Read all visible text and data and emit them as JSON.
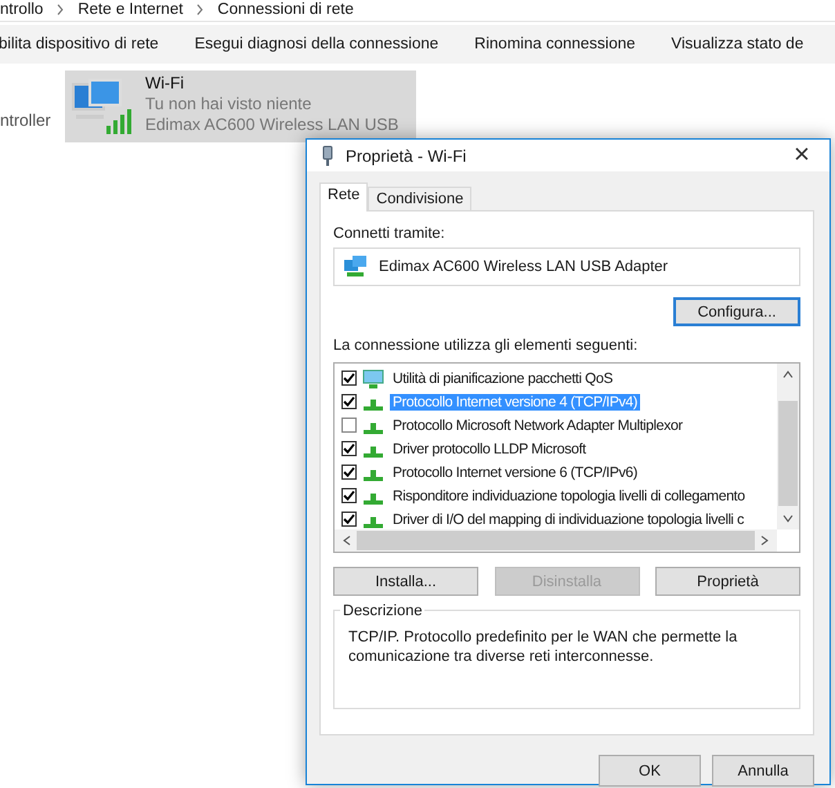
{
  "breadcrumb": [
    "ntrollo",
    "Rete e Internet",
    "Connessioni di rete"
  ],
  "toolbar": [
    "bilita dispositivo di rete",
    "Esegui diagnosi della connessione",
    "Rinomina connessione",
    "Visualizza stato de"
  ],
  "side_label": "ntroller",
  "connection": {
    "name": "Wi-Fi",
    "network": "Tu non hai visto niente",
    "adapter": "Edimax AC600 Wireless LAN USB",
    "selected": true
  },
  "dialog": {
    "title": "Proprietà - Wi-Fi",
    "close": "×",
    "tabs": [
      {
        "label": "Rete",
        "selected": true
      },
      {
        "label": "Condivisione",
        "selected": false
      }
    ],
    "connect_label": "Connetti tramite:",
    "adapter": "Edimax AC600 Wireless LAN USB Adapter",
    "configure": "Configura...",
    "items_label": "La connessione utilizza gli elementi seguenti:",
    "items": [
      {
        "kind": "service",
        "label": "Utilità di pianificazione pacchetti QoS",
        "checked": true,
        "selected": false
      },
      {
        "kind": "protocol",
        "label": "Protocollo Internet versione 4 (TCP/IPv4)",
        "checked": true,
        "selected": true
      },
      {
        "kind": "protocol",
        "label": "Protocollo Microsoft Network Adapter Multiplexor",
        "checked": false,
        "selected": false
      },
      {
        "kind": "protocol",
        "label": "Driver protocollo LLDP Microsoft",
        "checked": true,
        "selected": false
      },
      {
        "kind": "protocol",
        "label": "Protocollo Internet versione 6 (TCP/IPv6)",
        "checked": true,
        "selected": false
      },
      {
        "kind": "protocol",
        "label": "Risponditore individuazione topologia livelli di collegamento",
        "checked": true,
        "selected": false
      },
      {
        "kind": "protocol",
        "label": "Driver di I/O del mapping di individuazione topologia livelli c",
        "checked": true,
        "selected": false
      }
    ],
    "buttons": [
      {
        "label": "Installa...",
        "disabled": false
      },
      {
        "label": "Disinstalla",
        "disabled": true
      },
      {
        "label": "Proprietà",
        "disabled": false
      }
    ],
    "description_title": "Descrizione",
    "description": "TCP/IP. Protocollo predefinito per le WAN che permette la comunicazione tra diverse reti interconnesse.",
    "footer": [
      {
        "label": "OK"
      },
      {
        "label": "Annulla"
      }
    ]
  }
}
